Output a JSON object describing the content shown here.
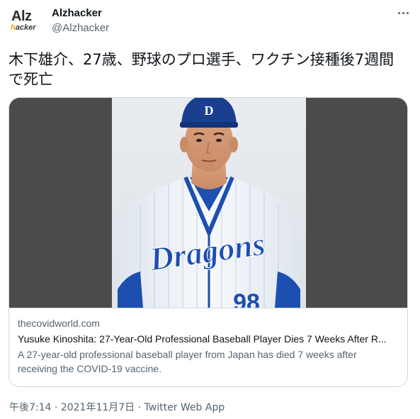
{
  "author": {
    "display_name": "Alzhacker",
    "handle": "@Alzhacker",
    "avatar_text_top": "Alz",
    "avatar_text_bottom_a": "h",
    "avatar_text_bottom_b": "acker"
  },
  "tweet": {
    "text": "木下雄介、27歳、野球のプロ選手、ワクチン接種後7週間で死亡"
  },
  "card": {
    "domain": "thecovidworld.com",
    "title": "Yusuke Kinoshita: 27-Year-Old Professional Baseball Player Dies 7 Weeks After R...",
    "description": "A 27-year-old professional baseball player from Japan has died 7 weeks after receiving the COVID-19 vaccine.",
    "jersey_text": "Dragons",
    "jersey_number": "98"
  },
  "meta": {
    "time": "午後7:14",
    "separator1": " · ",
    "date": "2021年11月7日",
    "separator2": " · ",
    "source": "Twitter Web App"
  },
  "colors": {
    "text_primary": "#0f1419",
    "text_secondary": "#536471",
    "border": "#cfd9de",
    "card_bg": "#4b4b4b",
    "dragons_blue": "#1c4fb0"
  },
  "icons": {
    "more": "more-horizontal-icon"
  }
}
